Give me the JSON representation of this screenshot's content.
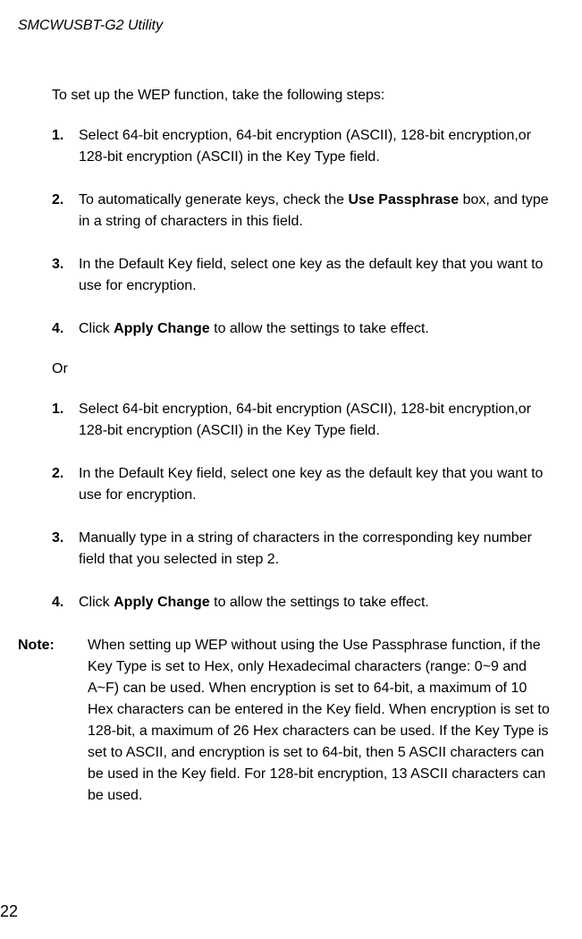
{
  "header": {
    "title": "SMCWUSBT-G2 Utility"
  },
  "intro": "To set up the WEP function, take the following steps:",
  "list1": {
    "items": [
      {
        "num": "1.",
        "text_before": "Select 64-bit encryption, 64-bit encryption (ASCII), 128-bit encryption,or 128-bit encryption (ASCII) in the Key Type field.",
        "bold": "",
        "text_after": ""
      },
      {
        "num": "2.",
        "text_before": "To automatically generate keys, check the ",
        "bold": "Use Passphrase",
        "text_after": " box, and type in a string of characters in this field."
      },
      {
        "num": "3.",
        "text_before": "In the Default Key field, select one key as the default key that you want to use for encryption.",
        "bold": "",
        "text_after": ""
      },
      {
        "num": "4.",
        "text_before": "Click ",
        "bold": "Apply Change",
        "text_after": " to allow the settings to take effect."
      }
    ]
  },
  "or": "Or",
  "list2": {
    "items": [
      {
        "num": "1.",
        "text_before": "Select 64-bit encryption, 64-bit encryption (ASCII), 128-bit encryption,or 128-bit encryption (ASCII) in the Key Type field.",
        "bold": "",
        "text_after": ""
      },
      {
        "num": "2.",
        "text_before": "In the Default Key field, select one key as the default key that you want to use for encryption.",
        "bold": "",
        "text_after": ""
      },
      {
        "num": "3.",
        "text_before": "Manually type in a string of characters in the corresponding key number field that you selected in step 2.",
        "bold": "",
        "text_after": ""
      },
      {
        "num": "4.",
        "text_before": "Click ",
        "bold": "Apply Change",
        "text_after": " to allow the settings to take effect."
      }
    ]
  },
  "note": {
    "label": "Note:",
    "content": "When setting up WEP without using the Use Passphrase function, if the Key Type is set to Hex, only Hexadecimal characters (range: 0~9 and A~F) can be used. When encryption is set to 64-bit, a maximum of 10 Hex characters can be entered in the Key field. When encryption is set to 128-bit, a maximum of 26 Hex characters can be used. If the Key Type is set to ASCII, and encryption is set to 64-bit, then 5 ASCII characters can be used in the Key field. For 128-bit encryption, 13 ASCII characters can be used."
  },
  "page_number": "22"
}
